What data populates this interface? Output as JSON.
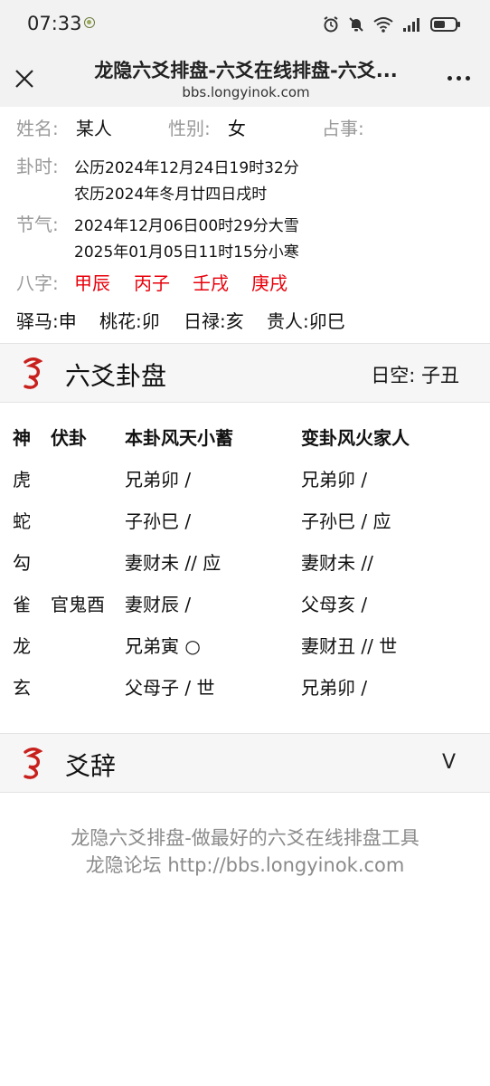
{
  "status": {
    "time": "07:33"
  },
  "nav": {
    "title": "龙隐六爻排盘-六爻在线排盘-六爻...",
    "url": "bbs.longyinok.com"
  },
  "info": {
    "name_label": "姓名:",
    "name_value": "某人",
    "gender_label": "性别:",
    "gender_value": "女",
    "matter_label": "占事:",
    "time_label": "卦时:",
    "solar": "公历2024年12月24日19时32分",
    "lunar": "农历2024年冬月廿四日戌时",
    "jieqi_label": "节气:",
    "jieqi1": "2024年12月06日00时29分大雪",
    "jieqi2": "2025年01月05日11时15分小寒",
    "bazi_label": "八字:",
    "bazi": [
      "甲辰",
      "丙子",
      "壬戌",
      "庚戌"
    ],
    "shensha": [
      "驿马:申",
      "桃花:卯",
      "日禄:亥",
      "贵人:卯巳"
    ]
  },
  "gua": {
    "title": "六爻卦盘",
    "kong": "日空:  子丑",
    "headers": {
      "shen": "神",
      "fu": "伏卦",
      "ben": "本卦风天小蓄",
      "bian": "变卦风火家人"
    },
    "rows": [
      {
        "shen": "虎",
        "fu": "",
        "ben": "兄弟卯  /",
        "bian": "兄弟卯  /"
      },
      {
        "shen": "蛇",
        "fu": "",
        "ben": "子孙巳  /",
        "bian": "子孙巳  /   应"
      },
      {
        "shen": "勾",
        "fu": "",
        "ben": "妻财未 // 应",
        "bian": "妻财未 //"
      },
      {
        "shen": "雀",
        "fu": "官鬼酉",
        "ben": "妻财辰  /",
        "bian": "父母亥  /"
      },
      {
        "shen": "龙",
        "fu": "",
        "ben": "兄弟寅 ○",
        "bian": "妻财丑 // 世"
      },
      {
        "shen": "玄",
        "fu": "",
        "ben": "父母子  /   世",
        "bian": "兄弟卯  /"
      }
    ]
  },
  "yaoci": {
    "title": "爻辞",
    "toggle": "V"
  },
  "footer": {
    "line1": "龙隐六爻排盘-做最好的六爻在线排盘工具",
    "line2": "龙隐论坛 http://bbs.longyinok.com"
  },
  "colors": {
    "accent_red": "#e8000b",
    "label_gray": "#9a9a9a"
  }
}
